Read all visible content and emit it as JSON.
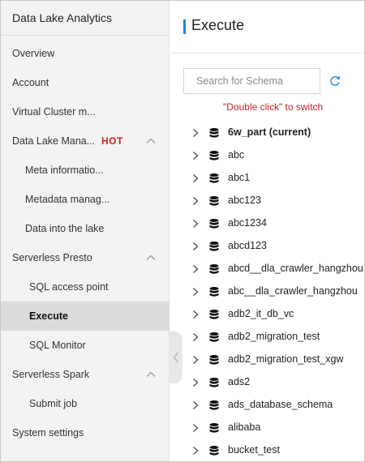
{
  "sidebar": {
    "title": "Data Lake Analytics",
    "items": [
      {
        "label": "Overview"
      },
      {
        "label": "Account"
      },
      {
        "label": "Virtual Cluster m..."
      },
      {
        "label": "Data Lake Mana...",
        "badge": "HOT",
        "expanded": true
      },
      {
        "label": "Meta informatio..."
      },
      {
        "label": "Metadata manag..."
      },
      {
        "label": "Data into the lake"
      },
      {
        "label": "Serverless Presto",
        "expanded": true
      },
      {
        "label": "SQL access point"
      },
      {
        "label": "Execute",
        "active": true
      },
      {
        "label": "SQL Monitor"
      },
      {
        "label": "Serverless Spark",
        "expanded": true
      },
      {
        "label": "Submit job"
      },
      {
        "label": "System settings"
      }
    ]
  },
  "main": {
    "title": "Execute",
    "search": {
      "placeholder": "Search for Schema",
      "value": ""
    },
    "hint": "\"Double click\" to switch",
    "schemas": [
      {
        "name": "6w_part (current)",
        "current": true
      },
      {
        "name": "abc"
      },
      {
        "name": "abc1"
      },
      {
        "name": "abc123"
      },
      {
        "name": "abc1234"
      },
      {
        "name": "abcd123"
      },
      {
        "name": "abcd__dla_crawler_hangzhou"
      },
      {
        "name": "abc__dla_crawler_hangzhou"
      },
      {
        "name": "adb2_it_db_vc"
      },
      {
        "name": "adb2_migration_test"
      },
      {
        "name": "adb2_migration_test_xgw"
      },
      {
        "name": "ads2"
      },
      {
        "name": "ads_database_schema"
      },
      {
        "name": "alibaba"
      },
      {
        "name": "bucket_test"
      }
    ]
  },
  "colors": {
    "accent": "#1e88e5",
    "hot": "#d32121",
    "hint": "#c62121",
    "sidebar_bg": "#f3f3f3",
    "active_bg": "#dcdcdc"
  },
  "icons": {
    "refresh": "refresh-icon",
    "expand": "chevron-right-icon",
    "collapse": "chevron-up-icon",
    "database": "database-icon",
    "sidebar_toggle": "chevron-left-icon"
  }
}
